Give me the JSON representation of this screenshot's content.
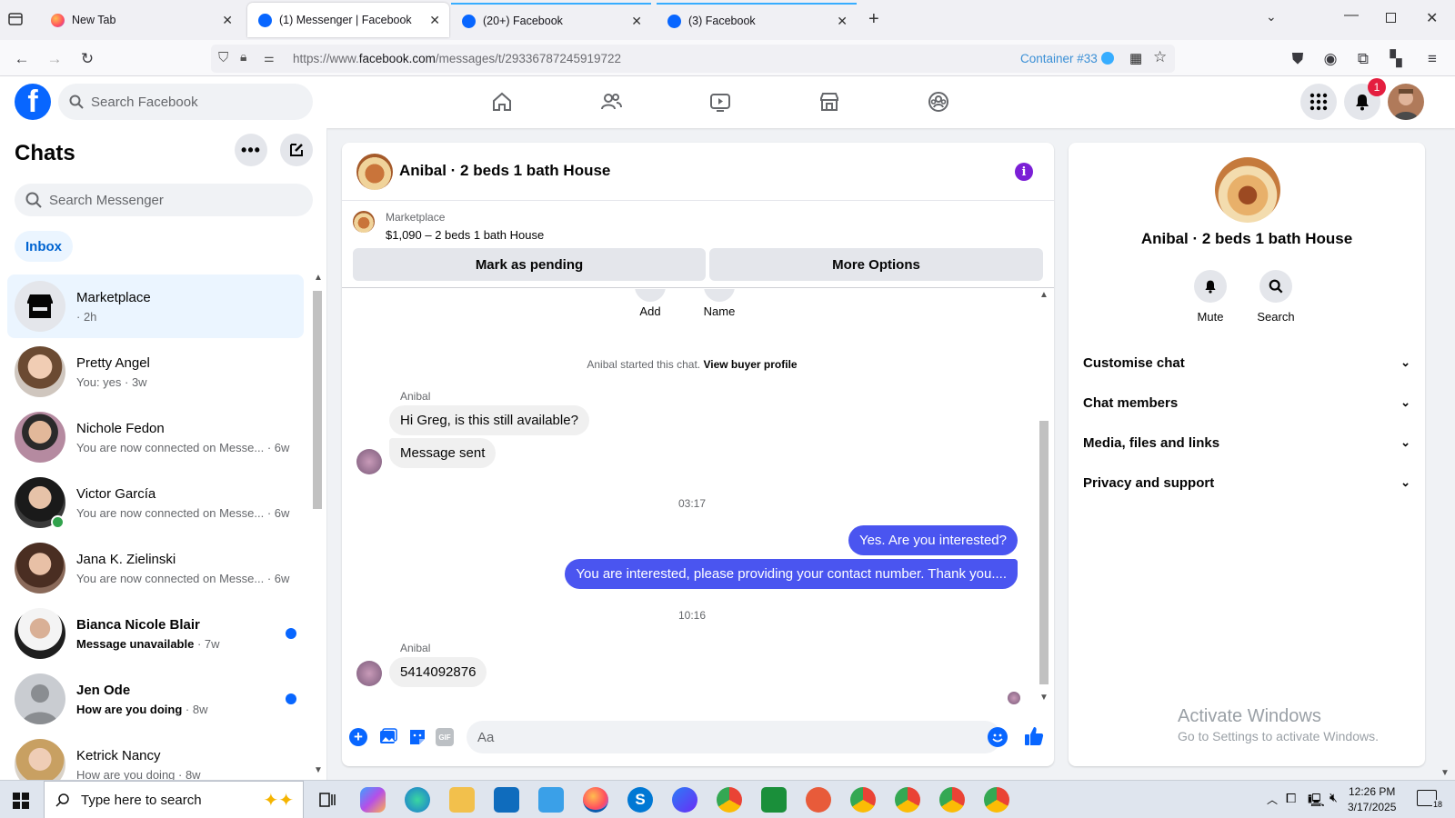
{
  "browser": {
    "tabs": [
      {
        "label": "New Tab",
        "favicon": "firefox-icon",
        "active": false
      },
      {
        "label": "(1) Messenger | Facebook",
        "favicon": "facebook-icon",
        "active": true
      },
      {
        "label": "(20+) Facebook",
        "favicon": "facebook-icon",
        "active": false
      },
      {
        "label": "(3) Facebook",
        "favicon": "facebook-icon",
        "active": false
      }
    ],
    "url_prefix": "https://www.",
    "url_domain": "facebook.com",
    "url_path": "/messages/t/29336787245919722",
    "container_label": "Container #33"
  },
  "fb": {
    "search_placeholder": "Search Facebook",
    "notification_count": "1"
  },
  "chats": {
    "title": "Chats",
    "search_placeholder": "Search Messenger",
    "inbox_label": "Inbox",
    "items": [
      {
        "name": "Marketplace",
        "sub": "· 2h",
        "selected": true
      },
      {
        "name": "Pretty Angel",
        "sub": "You: yes · 3w"
      },
      {
        "name": "Nichole Fedon",
        "sub": "You are now connected on Messe... · 6w"
      },
      {
        "name": "Victor García",
        "sub": "You are now connected on Messe... · 6w",
        "online": true
      },
      {
        "name": "Jana K. Zielinski",
        "sub": "You are now connected on Messe... · 6w"
      },
      {
        "name": "Bianca Nicole Blair",
        "sub_bold": "Message unavailable",
        "sub_time": " · 7w",
        "unread": true
      },
      {
        "name": "Jen Ode",
        "sub_bold": "How are you doing",
        "sub_time": " · 8w",
        "unread": true
      },
      {
        "name": "Ketrick Nancy",
        "sub": "How are you doing · 8w"
      }
    ]
  },
  "conversation": {
    "title": "Anibal · 2 beds 1 bath House",
    "listing_source": "Marketplace",
    "listing_title": "$1,090 – 2 beds 1 bath House",
    "mark_pending": "Mark as pending",
    "more_options": "More Options",
    "add_label": "Add",
    "name_label": "Name",
    "started_text": "Anibal started this chat.",
    "view_profile": "View buyer profile",
    "sender1": "Anibal",
    "msg1": "Hi Greg, is this still available?",
    "msg2": "Message sent",
    "time1": "03:17",
    "msg3": "Yes. Are you interested?",
    "msg4": "You are interested, please providing your contact number. Thank you....",
    "time2": "10:16",
    "sender2": "Anibal",
    "msg5": "5414092876",
    "compose_placeholder": "Aa"
  },
  "info": {
    "name": "Anibal · 2 beds 1 bath House",
    "mute_label": "Mute",
    "search_label": "Search",
    "sections": [
      "Customise chat",
      "Chat members",
      "Media, files and links",
      "Privacy and support"
    ],
    "activate_title": "Activate Windows",
    "activate_sub": "Go to Settings to activate Windows."
  },
  "taskbar": {
    "search_placeholder": "Type here to search",
    "time": "12:26 PM",
    "date": "3/17/2025",
    "notif_count": "18"
  },
  "colors": {
    "fb_blue": "#0866ff",
    "outgoing_bubble": "#4a55f0",
    "info_purple": "#7b1fd6"
  }
}
